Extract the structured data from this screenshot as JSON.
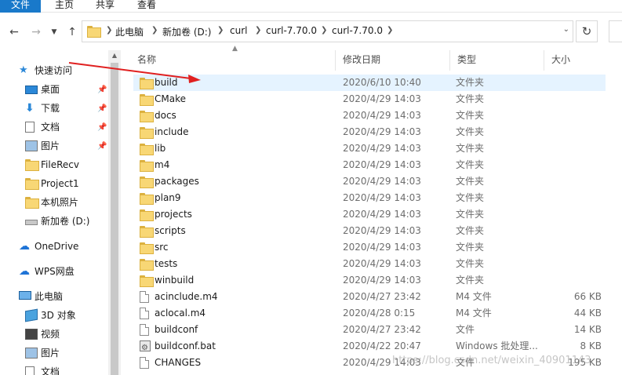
{
  "ribbon": {
    "tabs": [
      "文件",
      "主页",
      "共享",
      "查看"
    ]
  },
  "addressbar": {
    "crumbs": [
      "此电脑",
      "新加卷 (D:)",
      "curl",
      "curl-7.70.0",
      "curl-7.70.0"
    ]
  },
  "sidebar": {
    "items": [
      {
        "label": "快速访问",
        "icon": "star-icon"
      },
      {
        "label": "桌面",
        "icon": "desktop-icon",
        "pinned": true
      },
      {
        "label": "下载",
        "icon": "download-icon",
        "pinned": true
      },
      {
        "label": "文档",
        "icon": "document-icon",
        "pinned": true
      },
      {
        "label": "图片",
        "icon": "picture-icon",
        "pinned": true
      },
      {
        "label": "FileRecv",
        "icon": "folder-icon"
      },
      {
        "label": "Project1",
        "icon": "folder-icon"
      },
      {
        "label": "本机照片",
        "icon": "folder-icon"
      },
      {
        "label": "新加卷 (D:)",
        "icon": "drive-icon"
      },
      {
        "label": "OneDrive",
        "icon": "onedrive-icon"
      },
      {
        "label": "WPS网盘",
        "icon": "wps-cloud-icon"
      },
      {
        "label": "此电脑",
        "icon": "computer-icon"
      },
      {
        "label": "3D 对象",
        "icon": "3d-objects-icon"
      },
      {
        "label": "视频",
        "icon": "video-icon"
      },
      {
        "label": "图片",
        "icon": "picture-icon"
      },
      {
        "label": "文档",
        "icon": "document-icon"
      }
    ]
  },
  "list": {
    "columns": {
      "name": "名称",
      "date": "修改日期",
      "type": "类型",
      "size": "大小"
    },
    "rows": [
      {
        "name": "build",
        "date": "2020/6/10 10:40",
        "type": "文件夹",
        "size": "",
        "kind": "folder",
        "selected": true
      },
      {
        "name": "CMake",
        "date": "2020/4/29 14:03",
        "type": "文件夹",
        "size": "",
        "kind": "folder"
      },
      {
        "name": "docs",
        "date": "2020/4/29 14:03",
        "type": "文件夹",
        "size": "",
        "kind": "folder"
      },
      {
        "name": "include",
        "date": "2020/4/29 14:03",
        "type": "文件夹",
        "size": "",
        "kind": "folder"
      },
      {
        "name": "lib",
        "date": "2020/4/29 14:03",
        "type": "文件夹",
        "size": "",
        "kind": "folder"
      },
      {
        "name": "m4",
        "date": "2020/4/29 14:03",
        "type": "文件夹",
        "size": "",
        "kind": "folder"
      },
      {
        "name": "packages",
        "date": "2020/4/29 14:03",
        "type": "文件夹",
        "size": "",
        "kind": "folder"
      },
      {
        "name": "plan9",
        "date": "2020/4/29 14:03",
        "type": "文件夹",
        "size": "",
        "kind": "folder"
      },
      {
        "name": "projects",
        "date": "2020/4/29 14:03",
        "type": "文件夹",
        "size": "",
        "kind": "folder"
      },
      {
        "name": "scripts",
        "date": "2020/4/29 14:03",
        "type": "文件夹",
        "size": "",
        "kind": "folder"
      },
      {
        "name": "src",
        "date": "2020/4/29 14:03",
        "type": "文件夹",
        "size": "",
        "kind": "folder"
      },
      {
        "name": "tests",
        "date": "2020/4/29 14:03",
        "type": "文件夹",
        "size": "",
        "kind": "folder"
      },
      {
        "name": "winbuild",
        "date": "2020/4/29 14:03",
        "type": "文件夹",
        "size": "",
        "kind": "folder"
      },
      {
        "name": "acinclude.m4",
        "date": "2020/4/27 23:42",
        "type": "M4 文件",
        "size": "66 KB",
        "kind": "file"
      },
      {
        "name": "aclocal.m4",
        "date": "2020/4/28 0:15",
        "type": "M4 文件",
        "size": "44 KB",
        "kind": "file"
      },
      {
        "name": "buildconf",
        "date": "2020/4/27 23:42",
        "type": "文件",
        "size": "14 KB",
        "kind": "file"
      },
      {
        "name": "buildconf.bat",
        "date": "2020/4/22 20:47",
        "type": "Windows 批处理...",
        "size": "8 KB",
        "kind": "bat"
      },
      {
        "name": "CHANGES",
        "date": "2020/4/29 14:03",
        "type": "文件",
        "size": "195 KB",
        "kind": "file"
      }
    ]
  },
  "watermark": "https://blog.csdn.net/weixin_40901143",
  "colors": {
    "accent": "#1979ca",
    "selection": "#e5f3ff",
    "annotation_arrow": "#e02020"
  }
}
